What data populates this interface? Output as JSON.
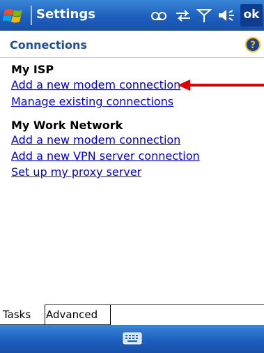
{
  "titlebar": {
    "title": "Settings",
    "ok_label": "ok",
    "icons": [
      "windows-start-icon",
      "voicemail-icon",
      "connectivity-icon",
      "signal-icon",
      "speaker-icon"
    ]
  },
  "header": {
    "title": "Connections",
    "help_icon": "help-icon"
  },
  "groups": [
    {
      "heading": "My ISP",
      "links": [
        "Add a new modem connection",
        "Manage existing connections"
      ]
    },
    {
      "heading": "My Work Network",
      "links": [
        "Add a new modem connection",
        "Add a new VPN server connection",
        "Set up my proxy server"
      ]
    }
  ],
  "tabs": [
    {
      "label": "Tasks",
      "selected": true
    },
    {
      "label": "Advanced",
      "selected": false
    }
  ],
  "menubar": {
    "icon": "keyboard-icon"
  },
  "colors": {
    "bar_blue": "#1d5fbf",
    "link_blue": "#0000e0",
    "header_blue": "#1f4fa3",
    "arrow_red": "#e00000"
  }
}
